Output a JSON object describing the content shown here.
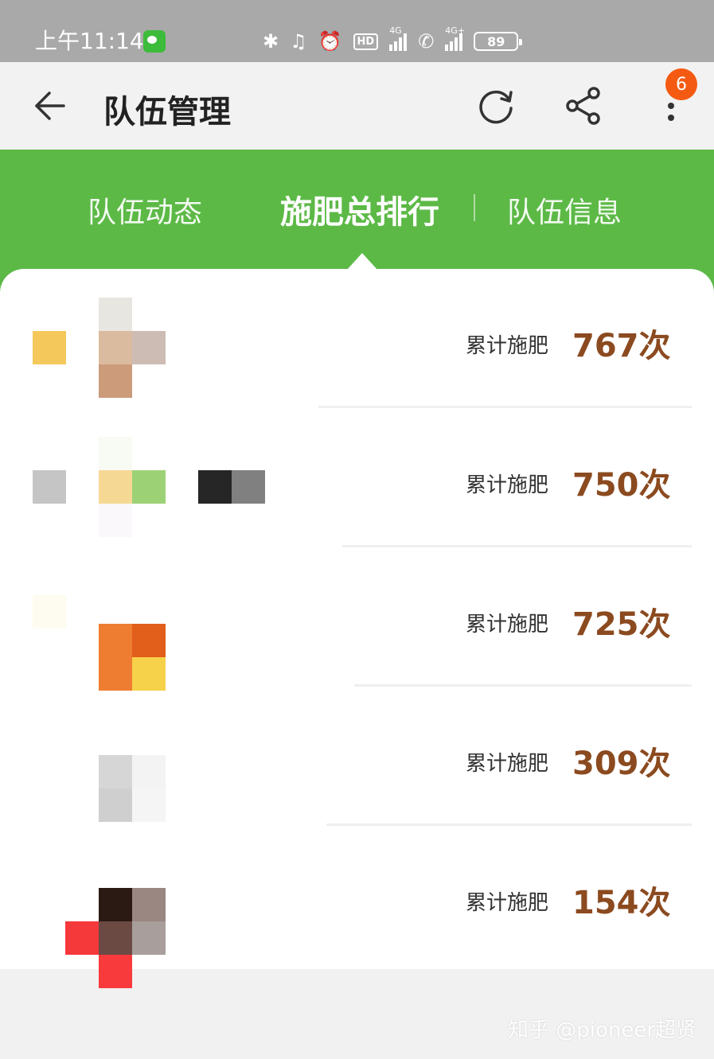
{
  "status_bar": {
    "time": "上午11:14",
    "network_label": "4G",
    "network_label_2": "4G+",
    "hd_label": "HD",
    "battery": "89"
  },
  "app_bar": {
    "title": "队伍管理",
    "notification_count": "6"
  },
  "tabs": [
    {
      "label": "队伍动态",
      "active": false
    },
    {
      "label": "施肥总排行",
      "active": true
    },
    {
      "label": "队伍信息",
      "active": false
    }
  ],
  "ranking": [
    {
      "label": "累计施肥",
      "value": "767次"
    },
    {
      "label": "累计施肥",
      "value": "750次"
    },
    {
      "label": "累计施肥",
      "value": "725次"
    },
    {
      "label": "累计施肥",
      "value": "309次"
    },
    {
      "label": "累计施肥",
      "value": "154次"
    }
  ],
  "watermark": "知乎 @pioneer超贤",
  "colors": {
    "accent_green": "#5cb946",
    "value_brown": "#8b4a1f",
    "badge_orange": "#f55a12"
  }
}
